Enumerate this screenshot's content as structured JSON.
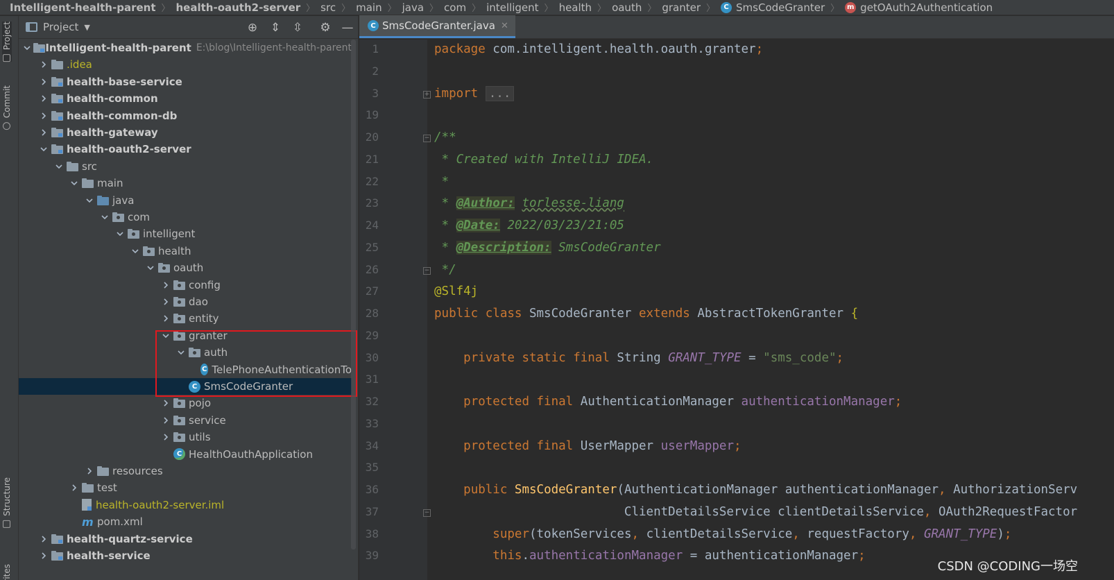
{
  "breadcrumb": [
    {
      "label": "Intelligent-health-parent",
      "bold": true
    },
    {
      "label": "health-oauth2-server",
      "bold": true
    },
    {
      "label": "src"
    },
    {
      "label": "main"
    },
    {
      "label": "java"
    },
    {
      "label": "com"
    },
    {
      "label": "intelligent"
    },
    {
      "label": "health"
    },
    {
      "label": "oauth"
    },
    {
      "label": "granter"
    },
    {
      "label": "SmsCodeGranter",
      "icon": "class-icon",
      "icon_letter": "C"
    },
    {
      "label": "getOAuth2Authentication",
      "icon": "method-icon",
      "icon_letter": "m"
    }
  ],
  "left_strip": {
    "project_tab": "Project",
    "commit_tab": "Commit",
    "structure_tab": "Structure",
    "favorites_tab": "rites"
  },
  "project_panel": {
    "title": "Project",
    "toolbar": [
      "locate-icon",
      "expand-all-icon",
      "collapse-all-icon",
      "gear-icon",
      "minimize-icon"
    ],
    "tree": [
      {
        "label": "Intelligent-health-parent",
        "path": "E:\\blog\\Intelligent-health-parent",
        "depth": 0,
        "arrow": "down",
        "icon": "module",
        "bold": true
      },
      {
        "label": ".idea",
        "depth": 1,
        "arrow": "right",
        "icon": "idea",
        "style": "idea"
      },
      {
        "label": "health-base-service",
        "depth": 1,
        "arrow": "right",
        "icon": "module",
        "bold": true
      },
      {
        "label": "health-common",
        "depth": 1,
        "arrow": "right",
        "icon": "module",
        "bold": true
      },
      {
        "label": "health-common-db",
        "depth": 1,
        "arrow": "right",
        "icon": "module",
        "bold": true
      },
      {
        "label": "health-gateway",
        "depth": 1,
        "arrow": "right",
        "icon": "module",
        "bold": true
      },
      {
        "label": "health-oauth2-server",
        "depth": 1,
        "arrow": "down",
        "icon": "module",
        "bold": true
      },
      {
        "label": "src",
        "depth": 2,
        "arrow": "down",
        "icon": "folder"
      },
      {
        "label": "main",
        "depth": 3,
        "arrow": "down",
        "icon": "folder"
      },
      {
        "label": "java",
        "depth": 4,
        "arrow": "down",
        "icon": "src"
      },
      {
        "label": "com",
        "depth": 5,
        "arrow": "down",
        "icon": "pkg"
      },
      {
        "label": "intelligent",
        "depth": 6,
        "arrow": "down",
        "icon": "pkg"
      },
      {
        "label": "health",
        "depth": 7,
        "arrow": "down",
        "icon": "pkg"
      },
      {
        "label": "oauth",
        "depth": 8,
        "arrow": "down",
        "icon": "pkg"
      },
      {
        "label": "config",
        "depth": 9,
        "arrow": "right",
        "icon": "pkg"
      },
      {
        "label": "dao",
        "depth": 9,
        "arrow": "right",
        "icon": "pkg"
      },
      {
        "label": "entity",
        "depth": 9,
        "arrow": "right",
        "icon": "pkg"
      },
      {
        "label": "granter",
        "depth": 9,
        "arrow": "down",
        "icon": "pkg"
      },
      {
        "label": "auth",
        "depth": 10,
        "arrow": "down",
        "icon": "pkg"
      },
      {
        "label": "TelePhoneAuthenticationTo",
        "depth": 11,
        "arrow": "none",
        "icon": "class"
      },
      {
        "label": "SmsCodeGranter",
        "depth": 10,
        "arrow": "none",
        "icon": "class",
        "selected": true
      },
      {
        "label": "pojo",
        "depth": 9,
        "arrow": "right",
        "icon": "pkg"
      },
      {
        "label": "service",
        "depth": 9,
        "arrow": "right",
        "icon": "pkg"
      },
      {
        "label": "utils",
        "depth": 9,
        "arrow": "right",
        "icon": "pkg"
      },
      {
        "label": "HealthOauthApplication",
        "depth": 9,
        "arrow": "none",
        "icon": "app"
      },
      {
        "label": "resources",
        "depth": 4,
        "arrow": "right",
        "icon": "folder"
      },
      {
        "label": "test",
        "depth": 3,
        "arrow": "right",
        "icon": "folder"
      },
      {
        "label": "health-oauth2-server.iml",
        "depth": 3,
        "arrow": "none",
        "icon": "file",
        "style": "iml"
      },
      {
        "label": "pom.xml",
        "depth": 3,
        "arrow": "none",
        "icon": "maven"
      },
      {
        "label": "health-quartz-service",
        "depth": 1,
        "arrow": "right",
        "icon": "module",
        "bold": true
      },
      {
        "label": "health-service",
        "depth": 1,
        "arrow": "right",
        "icon": "module",
        "bold": true
      }
    ]
  },
  "editor": {
    "tab_label": "SmsCodeGranter.java",
    "lines": [
      {
        "n": "1",
        "fold": "",
        "parts": [
          [
            "kw",
            "package "
          ],
          [
            "",
            "com.intelligent.health.oauth.granter"
          ],
          [
            "kw",
            ";"
          ]
        ]
      },
      {
        "n": "2",
        "fold": "",
        "parts": []
      },
      {
        "n": "3",
        "fold": "+",
        "parts": [
          [
            "kw",
            "import "
          ],
          [
            "ph",
            "..."
          ]
        ]
      },
      {
        "n": "19",
        "fold": "",
        "parts": []
      },
      {
        "n": "20",
        "fold": "-",
        "parts": [
          [
            "cm",
            "/**"
          ]
        ]
      },
      {
        "n": "21",
        "fold": "",
        "parts": [
          [
            "cm",
            " * Created with IntelliJ IDEA."
          ]
        ]
      },
      {
        "n": "22",
        "fold": "",
        "parts": [
          [
            "cm",
            " *"
          ]
        ]
      },
      {
        "n": "23",
        "fold": "",
        "parts": [
          [
            "cm",
            " * "
          ],
          [
            "tag",
            "@Author:"
          ],
          [
            "cm",
            " "
          ],
          [
            "cmsq",
            "torlesse-liang"
          ]
        ]
      },
      {
        "n": "24",
        "fold": "",
        "parts": [
          [
            "cm",
            " * "
          ],
          [
            "tag",
            "@Date:"
          ],
          [
            "cm",
            " 2022/03/23/21:05"
          ]
        ]
      },
      {
        "n": "25",
        "fold": "",
        "parts": [
          [
            "cm",
            " * "
          ],
          [
            "tag",
            "@Description:"
          ],
          [
            "cm",
            " SmsCodeGranter"
          ]
        ]
      },
      {
        "n": "26",
        "fold": "-",
        "parts": [
          [
            "cm",
            " */"
          ]
        ]
      },
      {
        "n": "27",
        "fold": "",
        "parts": [
          [
            "ann",
            "@Slf4j"
          ]
        ]
      },
      {
        "n": "28",
        "fold": "",
        "parts": [
          [
            "kw",
            "public class "
          ],
          [
            "",
            "SmsCodeGranter "
          ],
          [
            "kw",
            "extends "
          ],
          [
            "",
            "AbstractTokenGranter "
          ],
          [
            "ann",
            "{"
          ]
        ]
      },
      {
        "n": "29",
        "fold": "",
        "parts": []
      },
      {
        "n": "30",
        "fold": "",
        "parts": [
          [
            "",
            "    "
          ],
          [
            "kw",
            "private static final "
          ],
          [
            "",
            "String "
          ],
          [
            "cfield",
            "GRANT_TYPE"
          ],
          [
            "",
            " = "
          ],
          [
            "str",
            "\"sms_code\""
          ],
          [
            "kw",
            ";"
          ]
        ]
      },
      {
        "n": "31",
        "fold": "",
        "parts": []
      },
      {
        "n": "32",
        "fold": "",
        "parts": [
          [
            "",
            "    "
          ],
          [
            "kw",
            "protected final "
          ],
          [
            "",
            "AuthenticationManager "
          ],
          [
            "field",
            "authenticationManager"
          ],
          [
            "kw",
            ";"
          ]
        ]
      },
      {
        "n": "33",
        "fold": "",
        "parts": []
      },
      {
        "n": "34",
        "fold": "",
        "parts": [
          [
            "",
            "    "
          ],
          [
            "kw",
            "protected final "
          ],
          [
            "",
            "UserMapper "
          ],
          [
            "field",
            "userMapper"
          ],
          [
            "kw",
            ";"
          ]
        ]
      },
      {
        "n": "35",
        "fold": "",
        "parts": []
      },
      {
        "n": "36",
        "fold": "",
        "parts": [
          [
            "",
            "    "
          ],
          [
            "kw",
            "public "
          ],
          [
            "fn",
            "SmsCodeGranter"
          ],
          [
            "",
            "(AuthenticationManager authenticationManager"
          ],
          [
            "kw",
            ", "
          ],
          [
            "",
            "AuthorizationServ"
          ]
        ]
      },
      {
        "n": "37",
        "fold": "-",
        "parts": [
          [
            "",
            "                          ClientDetailsService clientDetailsService"
          ],
          [
            "kw",
            ", "
          ],
          [
            "",
            "OAuth2RequestFactor"
          ]
        ]
      },
      {
        "n": "38",
        "fold": "",
        "parts": [
          [
            "",
            "        "
          ],
          [
            "kw",
            "super"
          ],
          [
            "",
            "(tokenServices"
          ],
          [
            "kw",
            ", "
          ],
          [
            "",
            "clientDetailsService"
          ],
          [
            "kw",
            ", "
          ],
          [
            "",
            "requestFactory"
          ],
          [
            "kw",
            ", "
          ],
          [
            "cfield",
            "GRANT_TYPE"
          ],
          [
            "",
            ")"
          ],
          [
            "kw",
            ";"
          ]
        ]
      },
      {
        "n": "39",
        "fold": "",
        "parts": [
          [
            "",
            "        "
          ],
          [
            "kw",
            "this"
          ],
          [
            "",
            "."
          ],
          [
            "field",
            "authenticationManager"
          ],
          [
            "",
            " = authenticationManager"
          ],
          [
            "kw",
            ";"
          ]
        ]
      }
    ]
  },
  "watermark": "CSDN @CODING一场空"
}
